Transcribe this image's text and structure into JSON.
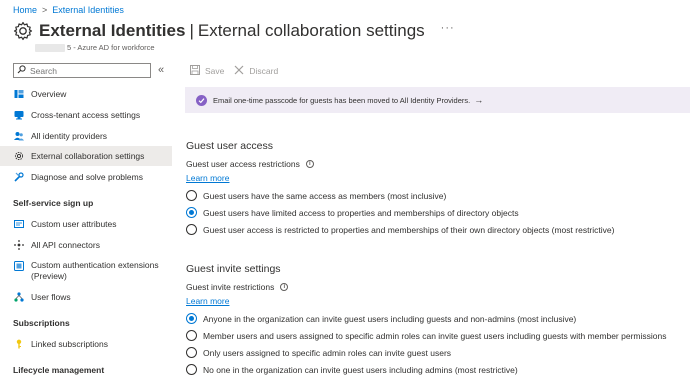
{
  "breadcrumb": {
    "home": "Home",
    "separator": ">",
    "current": "External Identities"
  },
  "header": {
    "title_main": "External Identities",
    "title_sep": "|",
    "title_sub": "External collaboration settings",
    "more": "···",
    "tenant_suffix": "5 - Azure AD for workforce"
  },
  "sidebar": {
    "search_placeholder": "Search",
    "collapse": "«",
    "items": [
      {
        "label": "Overview",
        "icon": "overview-icon"
      },
      {
        "label": "Cross-tenant access settings",
        "icon": "cross-tenant-icon"
      },
      {
        "label": "All identity providers",
        "icon": "people-icon"
      },
      {
        "label": "External collaboration settings",
        "icon": "gear-icon",
        "selected": true
      },
      {
        "label": "Diagnose and solve problems",
        "icon": "wrench-icon"
      }
    ],
    "section_signup": "Self-service sign up",
    "signup_items": [
      {
        "label": "Custom user attributes",
        "icon": "attributes-icon"
      },
      {
        "label": "All API connectors",
        "icon": "connector-icon"
      },
      {
        "label": "Custom authentication extensions",
        "label2": "(Preview)",
        "icon": "extension-icon"
      },
      {
        "label": "User flows",
        "icon": "flow-icon"
      }
    ],
    "section_subscriptions": "Subscriptions",
    "subscription_items": [
      {
        "label": "Linked subscriptions",
        "icon": "key-icon"
      }
    ],
    "section_lifecycle": "Lifecycle management"
  },
  "toolbar": {
    "save": "Save",
    "discard": "Discard"
  },
  "banner": {
    "text": "Email one-time passcode for guests has been moved to All Identity Providers.",
    "arrow": "→"
  },
  "guest_access": {
    "title": "Guest user access",
    "label": "Guest user access restrictions",
    "info": "i",
    "learn_more": "Learn more",
    "options": [
      "Guest users have the same access as members (most inclusive)",
      "Guest users have limited access to properties and memberships of directory objects",
      "Guest user access is restricted to properties and memberships of their own directory objects (most restrictive)"
    ],
    "selected_index": 1
  },
  "guest_invite": {
    "title": "Guest invite settings",
    "label": "Guest invite restrictions",
    "info": "i",
    "learn_more": "Learn more",
    "options": [
      "Anyone in the organization can invite guest users including guests and non-admins (most inclusive)",
      "Member users and users assigned to specific admin roles can invite guest users including guests with member permissions",
      "Only users assigned to specific admin roles can invite guest users",
      "No one in the organization can invite guest users including admins (most restrictive)"
    ],
    "selected_index": 0
  },
  "colors": {
    "accent": "#0078d4",
    "banner_bg": "#f0ecf5",
    "banner_badge": "#8661c5",
    "selected_nav": "#edebe9"
  }
}
